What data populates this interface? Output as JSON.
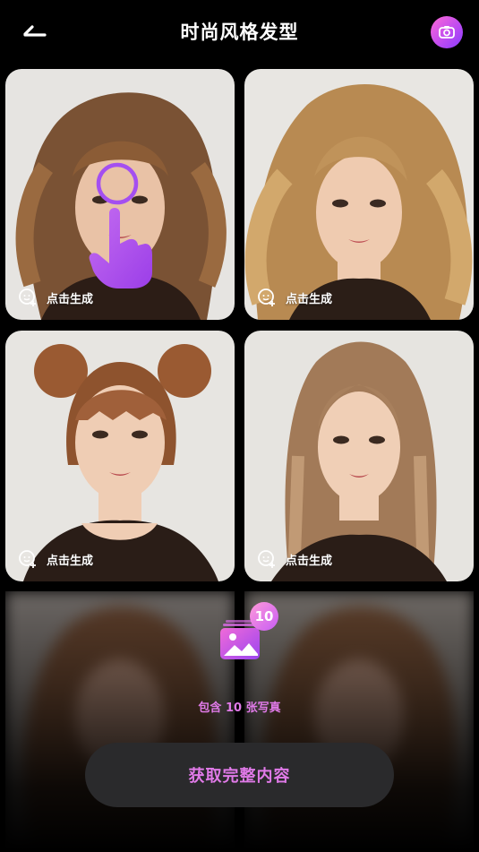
{
  "header": {
    "title": "时尚风格发型",
    "back_icon": "back-arrow-icon",
    "camera_icon": "camera-icon",
    "accent": "#c04cf0"
  },
  "cards": [
    {
      "label": "点击生成",
      "style": "long-wavy-brown"
    },
    {
      "label": "点击生成",
      "style": "voluminous-blonde-waves"
    },
    {
      "label": "点击生成",
      "style": "space-buns-bangs"
    },
    {
      "label": "点击生成",
      "style": "long-straight-ash"
    }
  ],
  "bundle": {
    "count_badge": "10",
    "text": "包含 10 张写真",
    "button_label": "获取完整内容",
    "accent": "#e07ae8"
  }
}
